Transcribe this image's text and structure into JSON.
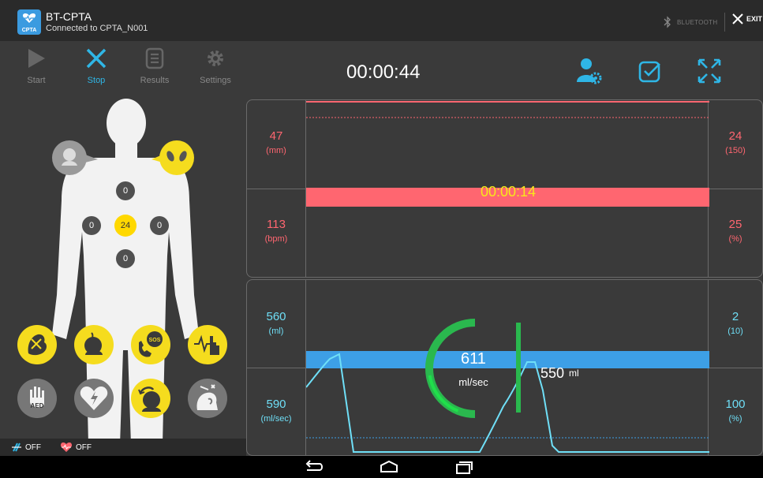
{
  "app": {
    "logo_text": "CPTA",
    "title": "BT-CPTA",
    "subtitle": "Connected to CPTA_N001",
    "bluetooth_label": "BLUETOOTH",
    "exit_label": "EXIT"
  },
  "toolbar": {
    "start_label": "Start",
    "stop_label": "Stop",
    "results_label": "Results",
    "settings_label": "Settings",
    "timer": "00:00:44",
    "icons": [
      "user-settings-icon",
      "checkbox-icon",
      "fullscreen-icon"
    ]
  },
  "body": {
    "top_value": "0",
    "left_value": "0",
    "center_value": "24",
    "right_value": "0",
    "bottom_value": "0",
    "actions": [
      "airway-obstruction-icon",
      "breathing-icon",
      "sos-call-icon",
      "pulse-check-icon",
      "aed-icon",
      "heart-shock-icon",
      "rescue-breath-icon",
      "head-tilt-icon"
    ],
    "aed_text": "AED"
  },
  "status": {
    "compression_label": "OFF",
    "heart_label": "OFF"
  },
  "compression_panel": {
    "left_top_value": "47",
    "left_top_unit": "(mm)",
    "left_bottom_value": "113",
    "left_bottom_unit": "(bpm)",
    "right_top_value": "24",
    "right_top_unit": "(150)",
    "right_bottom_value": "25",
    "right_bottom_unit": "(%)",
    "bar_timer": "00:00:14",
    "color": "#ff6670"
  },
  "ventilation_panel": {
    "left_top_value": "560",
    "left_top_unit": "(ml)",
    "left_bottom_value": "590",
    "left_bottom_unit": "(ml/sec)",
    "right_top_value": "2",
    "right_top_unit": "(10)",
    "right_bottom_value": "100",
    "right_bottom_unit": "(%)",
    "flow_value": "611",
    "flow_unit": "ml/sec",
    "volume_value": "550",
    "volume_unit": "ml",
    "color": "#6fdff7"
  }
}
